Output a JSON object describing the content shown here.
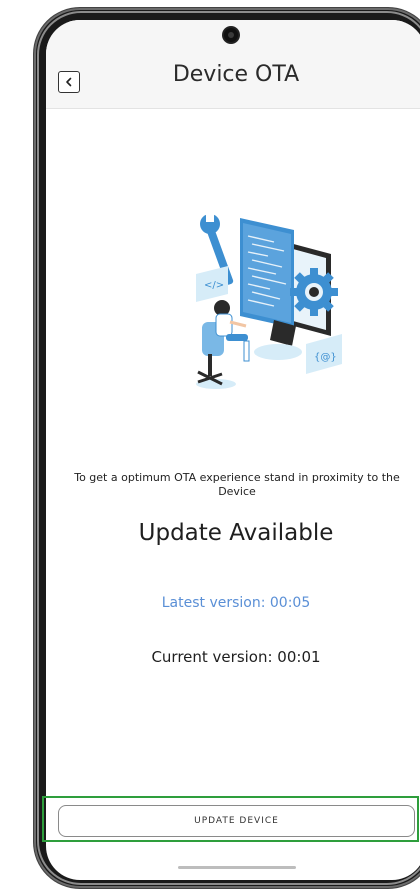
{
  "header": {
    "title": "Device OTA",
    "back_icon": "chevron-left-icon"
  },
  "illustration": {
    "icon": "developer-workstation-illustration",
    "colors": {
      "primary": "#3d8fd1",
      "secondary": "#7ab8e6",
      "light": "#d6ecf8",
      "dark": "#2a2a2a"
    }
  },
  "content": {
    "proximity_note": "To get a optimum OTA experience stand in proximity to the Device",
    "status_heading": "Update Available",
    "latest_version": "Latest version: 00:05",
    "current_version": "Current version: 00:01"
  },
  "actions": {
    "update_button_label": "UPDATE DEVICE",
    "highlight_color": "#2e9e3c"
  }
}
